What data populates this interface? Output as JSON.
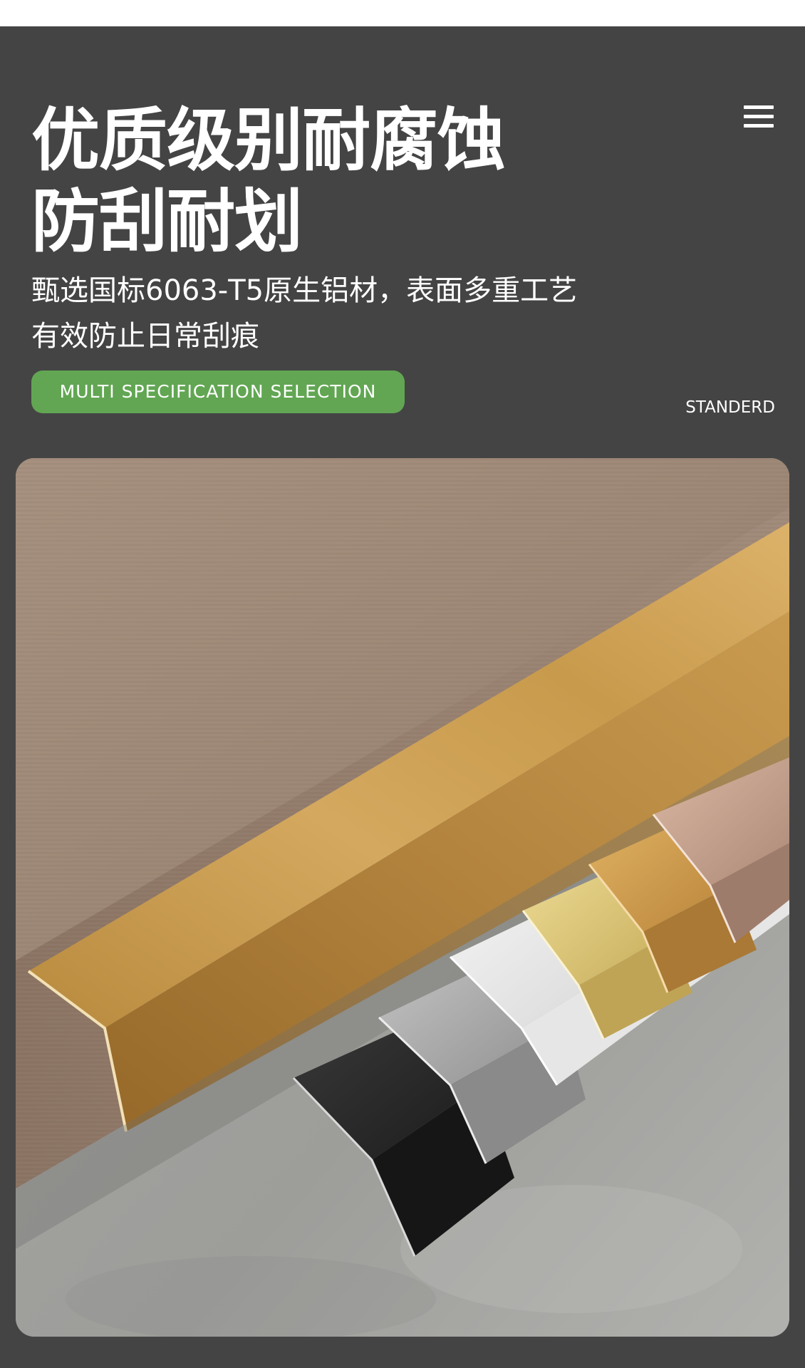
{
  "header": {
    "headline_line1": "优质级别耐腐蚀",
    "headline_line2": "防刮耐划",
    "menu_icon": "hamburger-menu-icon"
  },
  "intro": {
    "line1": "甄选国标6063-T5原生铝材，表面多重工艺",
    "line2": "有效防止日常刮痕"
  },
  "badge": {
    "label": "MULTI SPECIFICATION SELECTION",
    "color": "#62a653"
  },
  "standard_label": "STANDERD",
  "colors": {
    "background": "#444444",
    "text": "#ffffff"
  },
  "product_photo": {
    "subject": "aluminum L-shaped corner edge trim profiles",
    "finishes": [
      "gold",
      "rose gold",
      "champagne gold",
      "bright gold",
      "white",
      "silver",
      "black"
    ]
  }
}
